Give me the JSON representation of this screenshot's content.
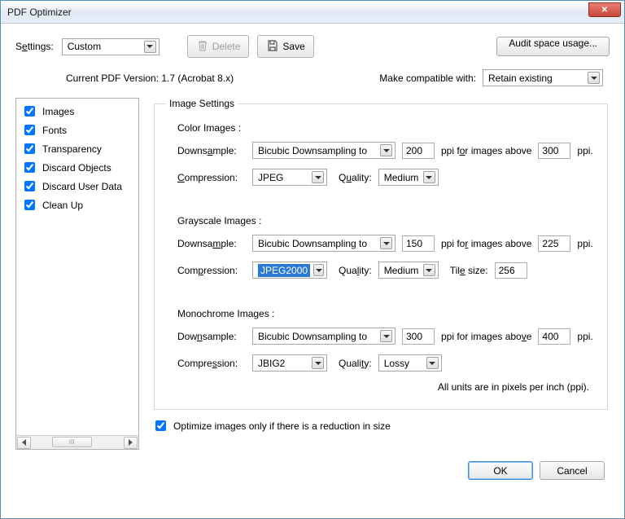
{
  "window": {
    "title": "PDF Optimizer"
  },
  "toolbar": {
    "settings_label_pre": "S",
    "settings_label_u": "e",
    "settings_label_post": "ttings:",
    "settings_value": "Custom",
    "delete_label": "Delete",
    "save_label": "Save",
    "audit_label": "Audit space usage..."
  },
  "infoRow": {
    "current_version_label": "Current PDF Version: 1.7 (Acrobat 8.x)",
    "compat_label": "Make compatible with:",
    "compat_value": "Retain existing"
  },
  "sidebar": {
    "items": [
      {
        "label": "Images",
        "checked": true
      },
      {
        "label": "Fonts",
        "checked": true
      },
      {
        "label": "Transparency",
        "checked": true
      },
      {
        "label": "Discard Objects",
        "checked": true
      },
      {
        "label": "Discard User Data",
        "checked": true
      },
      {
        "label": "Clean Up",
        "checked": true
      }
    ],
    "scroll_thumb_text": "III"
  },
  "panel": {
    "legend": "Image Settings",
    "color": {
      "heading": "Color Images :",
      "downsample_label_pre": "Downs",
      "downsample_label_u": "a",
      "downsample_label_post": "mple:",
      "downsample_method": "Bicubic Downsampling to",
      "ppi": "200",
      "ppi_above_label_pre": "ppi f",
      "ppi_above_label_u": "o",
      "ppi_above_label_post": "r images above",
      "ppi_above": "300",
      "ppi_unit": "ppi.",
      "compression_label_pre": "",
      "compression_label_u": "C",
      "compression_label_post": "ompression:",
      "compression": "JPEG",
      "quality_label_pre": "Q",
      "quality_label_u": "u",
      "quality_label_post": "ality:",
      "quality": "Medium"
    },
    "gray": {
      "heading": "Grayscale Images :",
      "downsample_label_pre": "Downsa",
      "downsample_label_u": "m",
      "downsample_label_post": "ple:",
      "downsample_method": "Bicubic Downsampling to",
      "ppi": "150",
      "ppi_above_label_pre": "ppi fo",
      "ppi_above_label_u": "r",
      "ppi_above_label_post": " images above",
      "ppi_above": "225",
      "ppi_unit": "ppi.",
      "compression_label_pre": "Com",
      "compression_label_u": "p",
      "compression_label_post": "ression:",
      "compression": "JPEG2000",
      "quality_label_pre": "Qua",
      "quality_label_u": "l",
      "quality_label_post": "ity:",
      "quality": "Medium",
      "tile_label_pre": "Til",
      "tile_label_u": "e",
      "tile_label_post": " size:",
      "tile": "256"
    },
    "mono": {
      "heading": "Monochrome Images :",
      "downsample_label_pre": "Dow",
      "downsample_label_u": "n",
      "downsample_label_post": "sample:",
      "downsample_method": "Bicubic Downsampling to",
      "ppi": "300",
      "ppi_above_label_pre": "ppi for images abo",
      "ppi_above_label_u": "v",
      "ppi_above_label_post": "e",
      "ppi_above": "400",
      "ppi_unit": "ppi.",
      "compression_label_pre": "Compre",
      "compression_label_u": "s",
      "compression_label_post": "sion:",
      "compression": "JBIG2",
      "quality_label_pre": "Quali",
      "quality_label_u": "t",
      "quality_label_post": "y:",
      "quality": "Lossy"
    },
    "units_note": "All units are in pixels per inch (ppi).",
    "optimize_checkbox_label": "Optimize images only if there is a reduction in size",
    "optimize_checked": true
  },
  "buttons": {
    "ok": "OK",
    "cancel": "Cancel"
  }
}
